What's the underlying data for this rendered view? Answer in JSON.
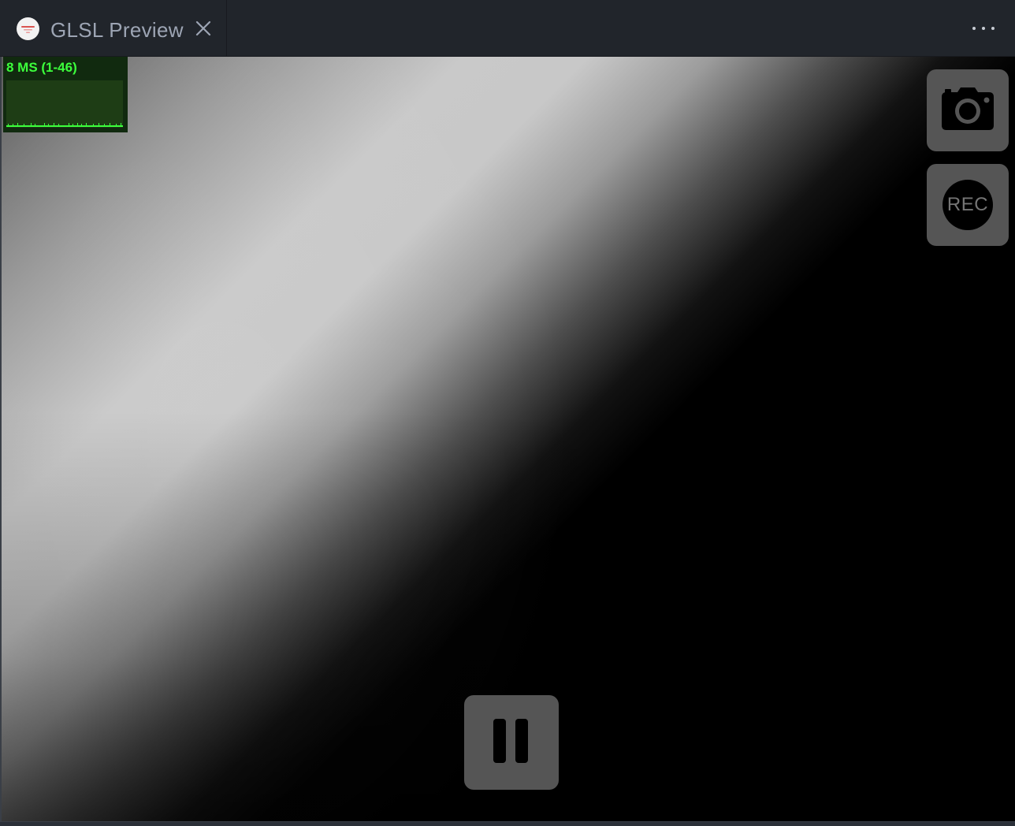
{
  "tab": {
    "icon": "shader-toy-logo-icon",
    "title": "GLSL Preview",
    "close_icon": "close-icon"
  },
  "header": {
    "more_icon": "ellipsis-icon"
  },
  "stats": {
    "label": "8 MS (1-46)",
    "color": "#3cff3c",
    "background": "#112a0f"
  },
  "controls": {
    "screenshot_icon": "camera-icon",
    "record_label": "REC",
    "pause_icon": "pause-icon"
  },
  "colors": {
    "tabbar": "#21252b",
    "tab_text": "#9da5b4",
    "button_bg": "#555555"
  }
}
